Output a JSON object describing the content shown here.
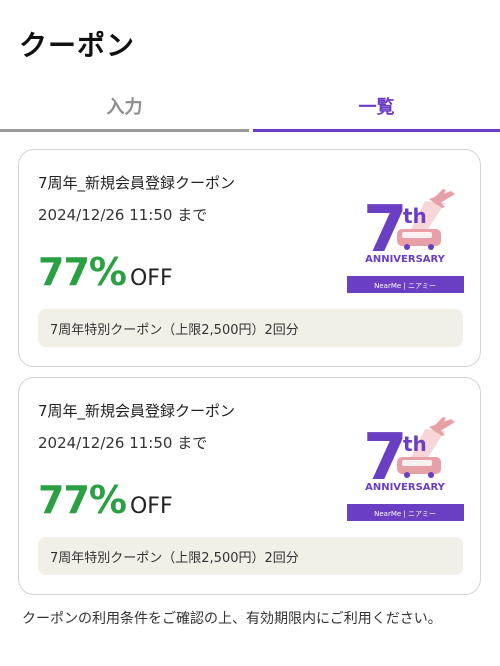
{
  "header": {
    "title": "クーポン"
  },
  "tabs": [
    {
      "label": "入力",
      "active": false
    },
    {
      "label": "一覧",
      "active": true
    }
  ],
  "coupons": [
    {
      "title": "7周年_新規会員登録クーポン",
      "expiry": "2024/12/26 11:50 まで",
      "discount": "77%",
      "discount_suffix": "OFF",
      "note": "7周年特別クーポン（上限2,500円）2回分",
      "badge": {
        "main": "7",
        "suffix": "th",
        "subtitle": "ANNIVERSARY",
        "brand": "NearMe | ニアミー"
      }
    },
    {
      "title": "7周年_新規会員登録クーポン",
      "expiry": "2024/12/26 11:50 まで",
      "discount": "77%",
      "discount_suffix": "OFF",
      "note": "7周年特別クーポン（上限2,500円）2回分",
      "badge": {
        "main": "7",
        "suffix": "th",
        "subtitle": "ANNIVERSARY",
        "brand": "NearMe | ニアミー"
      }
    }
  ],
  "footer": {
    "note": "クーポンの利用条件をご確認の上、有効期限内にご利用ください。"
  },
  "colors": {
    "accent": "#6a3dc8",
    "discount": "#2aa043",
    "note_bg": "#f2efe7",
    "badge_purple": "#6b3fc4",
    "badge_pink": "#e8a0a8"
  }
}
